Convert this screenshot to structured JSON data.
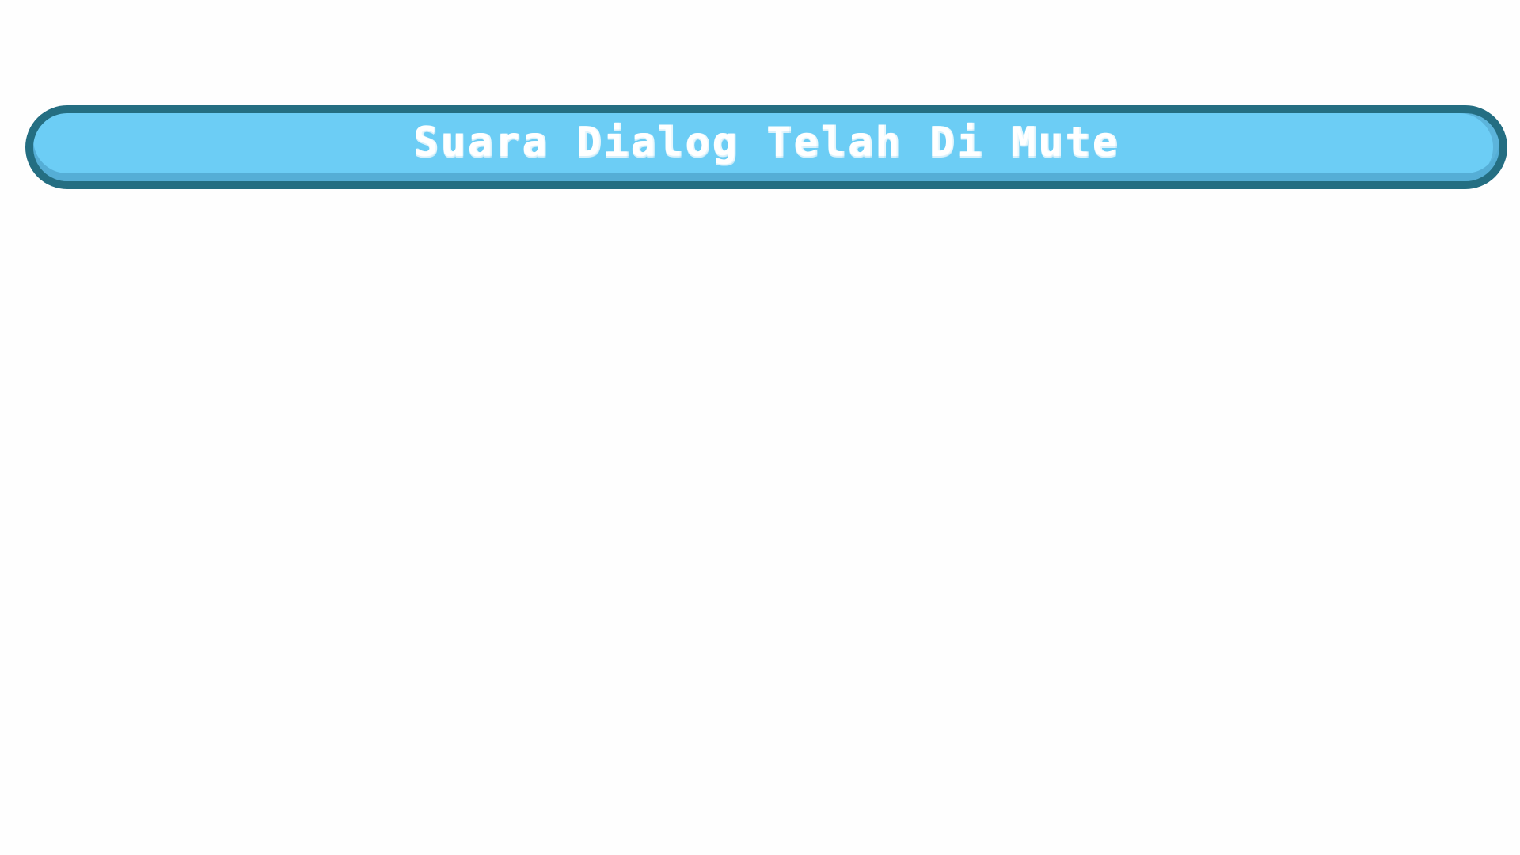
{
  "notification": {
    "message": "Suara Dialog Telah Di Mute"
  },
  "colors": {
    "background": "#fefefe",
    "banner_fill": "#6ccdf5",
    "banner_border": "#246e82",
    "banner_shade": "#55aed6",
    "text": "#ffffff"
  }
}
